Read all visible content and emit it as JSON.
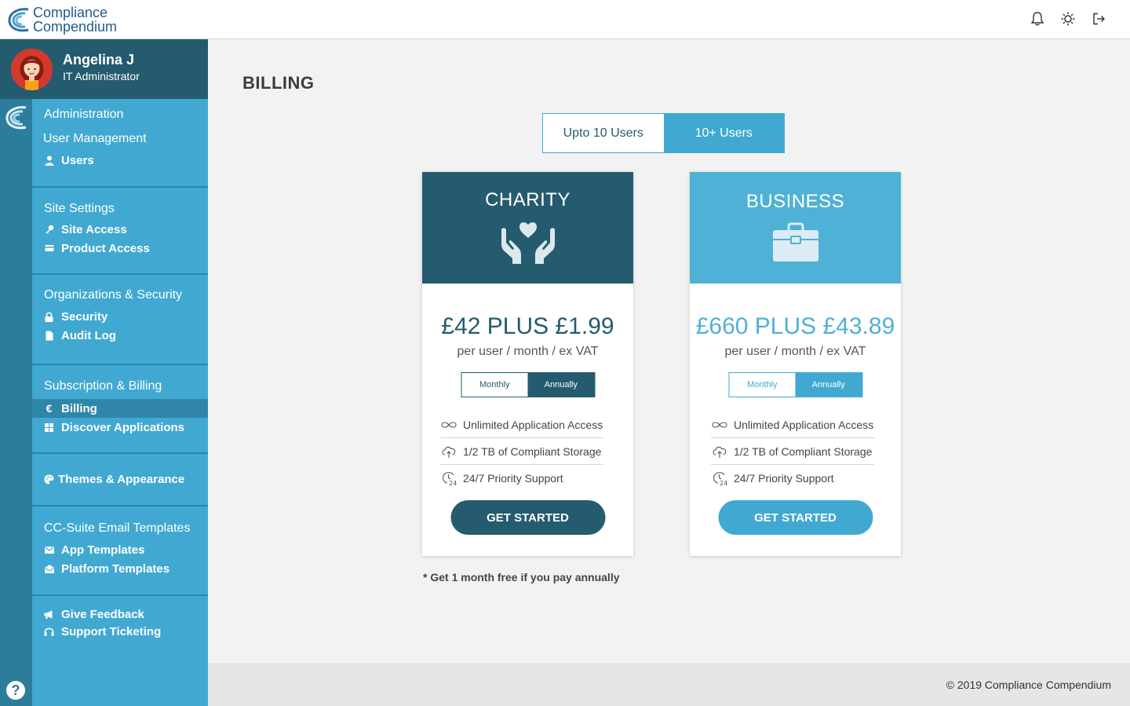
{
  "brand": {
    "line1": "Compliance",
    "line2": "Compendium"
  },
  "topbar": {
    "icons": [
      "bell-icon",
      "sun-icon",
      "logout-icon"
    ]
  },
  "profile": {
    "name": "Angelina J",
    "role": "IT Administrator"
  },
  "nav": {
    "heading": "Administration",
    "groups": [
      {
        "title": "User Management",
        "items": [
          {
            "label": "Users",
            "icon": "user-icon"
          }
        ]
      },
      {
        "title": "Site Settings",
        "items": [
          {
            "label": "Site Access",
            "icon": "key-icon"
          },
          {
            "label": "Product Access",
            "icon": "card-icon"
          }
        ]
      },
      {
        "title": "Organizations & Security",
        "items": [
          {
            "label": "Security",
            "icon": "lock-icon"
          },
          {
            "label": "Audit Log",
            "icon": "document-icon"
          }
        ]
      },
      {
        "title": "Subscription & Billing",
        "items": [
          {
            "label": "Billing",
            "icon": "euro-icon",
            "active": true
          },
          {
            "label": "Discover Applications",
            "icon": "grid-icon"
          }
        ]
      },
      {
        "title": "",
        "items": [
          {
            "label": "Themes & Appearance",
            "icon": "palette-icon"
          }
        ]
      },
      {
        "title": "CC-Suite Email Templates",
        "items": [
          {
            "label": "App Templates",
            "icon": "mail-icon"
          },
          {
            "label": "Platform Templates",
            "icon": "mail-open-icon"
          }
        ]
      },
      {
        "title": "",
        "items": [
          {
            "label": "Give Feedback",
            "icon": "megaphone-icon"
          },
          {
            "label": "Support Ticketing",
            "icon": "headset-icon"
          }
        ]
      }
    ]
  },
  "page": {
    "title": "BILLING"
  },
  "user_tabs": [
    {
      "label": "Upto 10 Users",
      "active": false
    },
    {
      "label": "10+ Users",
      "active": true
    }
  ],
  "plans": [
    {
      "name": "CHARITY",
      "icon": "heart-hands-icon",
      "color": "#245b6e",
      "price": "£42 PLUS £1.99",
      "per": "per user / month / ex VAT",
      "periods": [
        "Monthly",
        "Annually"
      ],
      "selected_period": "Annually",
      "features": [
        {
          "label": "Unlimited Application Access",
          "icon": "infinity-icon"
        },
        {
          "label": "1/2 TB of Compliant Storage",
          "icon": "cloud-upload-icon"
        },
        {
          "label": "24/7 Priority Support",
          "icon": "clock-24-icon"
        }
      ],
      "cta": "GET STARTED"
    },
    {
      "name": "BUSINESS",
      "icon": "briefcase-icon",
      "color": "#4fb1d5",
      "price": "£660 PLUS £43.89",
      "per": "per user / month / ex VAT",
      "periods": [
        "Monthly",
        "Annually"
      ],
      "selected_period": "Annually",
      "features": [
        {
          "label": "Unlimited Application Access",
          "icon": "infinity-icon"
        },
        {
          "label": "1/2 TB of Compliant Storage",
          "icon": "cloud-upload-icon"
        },
        {
          "label": "24/7 Priority Support",
          "icon": "clock-24-icon"
        }
      ],
      "cta": "GET STARTED"
    }
  ],
  "note": "* Get 1 month free if you pay annually",
  "footer": {
    "copyright": "© 2019 Compliance Compendium"
  }
}
